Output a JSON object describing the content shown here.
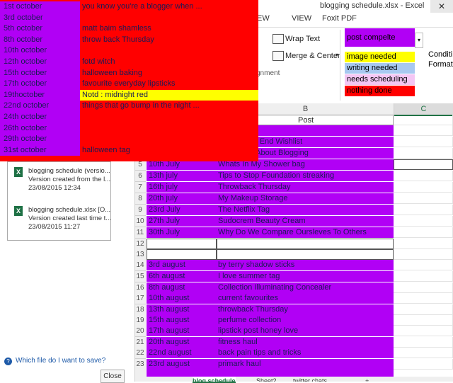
{
  "excel": {
    "title": "blogging schedule.xlsx - Excel",
    "close_icon": "close-icon",
    "tabs": [
      "IEW",
      "VIEW",
      "Foxit PDF"
    ],
    "ribbon": {
      "wrap_text": "Wrap Text",
      "merge_center": "Merge & Center",
      "alignment_label": "gnment",
      "conditional_formatting": "Conditi Formatti"
    },
    "legend": [
      {
        "label": "post compelte",
        "color": "#b100f5"
      },
      {
        "label": "image needed",
        "color": "#ffff00"
      },
      {
        "label": "writing needed",
        "color": "#a8c8f0"
      },
      {
        "label": "needs scheduling",
        "color": "#f4c6f4"
      },
      {
        "label": "nothing done",
        "color": "#ff0000"
      }
    ],
    "columns": {
      "B": "B",
      "C": "C"
    },
    "column_header_post": "Post"
  },
  "sheet": {
    "partial_rows": [
      {
        "num": "",
        "post": "The Break"
      },
      {
        "num": "",
        "post": "onday High End Wishlist"
      },
      {
        "num": "",
        "post": "ngs I Love About Blogging"
      }
    ],
    "rows": [
      {
        "num": "5",
        "date": "10th July",
        "post": "Whats In My Shower bag"
      },
      {
        "num": "6",
        "date": "13th july",
        "post": "Tips to Stop Foundation streaking"
      },
      {
        "num": "7",
        "date": "16th july",
        "post": "Throwback Thursday"
      },
      {
        "num": "8",
        "date": "20th july",
        "post": "My Makeup Storage"
      },
      {
        "num": "9",
        "date": "23rd July",
        "post": "The Netflix Tag"
      },
      {
        "num": "10",
        "date": "27th July",
        "post": "Sudocrem Beauty Cream"
      },
      {
        "num": "11",
        "date": "30th July",
        "post": "Why Do We Compare Oursleves To Others"
      },
      {
        "num": "12",
        "date": "",
        "post": ""
      },
      {
        "num": "13",
        "date": "",
        "post": ""
      },
      {
        "num": "14",
        "date": "3rd august",
        "post": "by terry shadow sticks"
      },
      {
        "num": "15",
        "date": "6th august",
        "post": "I love summer tag"
      },
      {
        "num": "16",
        "date": "8th august",
        "post": "Collection Illuminating Concealer"
      },
      {
        "num": "17",
        "date": "10th august",
        "post": "current favourites"
      },
      {
        "num": "18",
        "date": "13th august",
        "post": "throwback Thursday"
      },
      {
        "num": "19",
        "date": "15th august",
        "post": "perfume collection"
      },
      {
        "num": "20",
        "date": "17th august",
        "post": "lipstick post honey love"
      },
      {
        "num": "21",
        "date": "20th august",
        "post": "fitness haul"
      },
      {
        "num": "22",
        "date": "22nd august",
        "post": "back pain tips and tricks"
      },
      {
        "num": "23",
        "date": "23rd august",
        "post": "primark haul"
      }
    ],
    "tabs": [
      "...",
      "blog schedule",
      "Sheet2",
      "twitter chats",
      "+"
    ]
  },
  "recovery": {
    "items": [
      {
        "name": "blogging schedule (versio...",
        "desc": "Version created from the l...",
        "time": "23/08/2015 12:34"
      },
      {
        "name": "blogging schedule.xlsx  [O...",
        "desc": "Version created last time t...",
        "time": "23/08/2015 11:27"
      }
    ],
    "help": "Which file do I want to save?",
    "close": "Close"
  },
  "overlay": {
    "rows": [
      {
        "date": "1st october",
        "post": "you know you're a blogger when ...",
        "highlight": false
      },
      {
        "date": "3rd  october",
        "post": "",
        "highlight": false
      },
      {
        "date": "5th october",
        "post": "matt baim shamless",
        "highlight": false
      },
      {
        "date": "8th october",
        "post": "throw back Thursday",
        "highlight": false
      },
      {
        "date": "10th october",
        "post": "",
        "highlight": false
      },
      {
        "date": "12th october",
        "post": "fotd witch",
        "highlight": false
      },
      {
        "date": "15th october",
        "post": "halloween baking",
        "highlight": false
      },
      {
        "date": "17th october",
        "post": "favourite everyday lipsticks",
        "highlight": false
      },
      {
        "date": "19thoctober",
        "post": "Notd : midnight red",
        "highlight": true
      },
      {
        "date": "22nd october",
        "post": "things that go bump in the night ...",
        "highlight": false
      },
      {
        "date": "24th october",
        "post": "",
        "highlight": false
      },
      {
        "date": "26th october",
        "post": "",
        "highlight": false
      },
      {
        "date": "29th october",
        "post": "",
        "highlight": false
      },
      {
        "date": "31st october",
        "post": "halloween tag",
        "highlight": false
      }
    ]
  }
}
